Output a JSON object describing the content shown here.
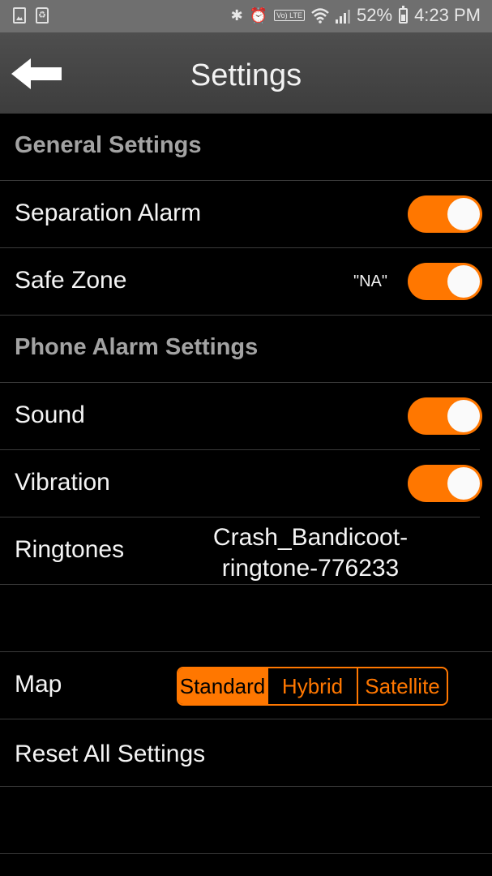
{
  "status_bar": {
    "left_icons": [
      "image-icon",
      "recycle-notification-icon"
    ],
    "right_icons": [
      "bluetooth-icon",
      "alarm-icon",
      "volte-icon",
      "wifi-icon",
      "signal-icon"
    ],
    "volte_label": "Vo) LTE",
    "battery_percent": "52%",
    "battery_level": 0.52,
    "time": "4:23 PM"
  },
  "app_bar": {
    "back_icon": "back-arrow-icon",
    "title": "Settings"
  },
  "general_section": {
    "title": "General Settings",
    "separation_alarm": {
      "label": "Separation Alarm",
      "on": true
    },
    "safe_zone": {
      "label": "Safe Zone",
      "value": "\"NA\"",
      "on": true
    }
  },
  "phone_alarm_section": {
    "title": "Phone Alarm Settings",
    "sound": {
      "label": "Sound",
      "on": true
    },
    "vibration": {
      "label": "Vibration",
      "on": true
    },
    "ringtones": {
      "label": "Ringtones",
      "value_line1": "Crash_Bandicoot-",
      "value_line2": "ringtone-776233"
    }
  },
  "map": {
    "label": "Map",
    "options": [
      "Standard",
      "Hybrid",
      "Satellite"
    ],
    "selected": "Standard"
  },
  "reset": {
    "label": "Reset All Settings"
  },
  "colors": {
    "accent": "#ff7700",
    "background": "#000000",
    "section_title": "#a3a3a3",
    "app_bar": "#444444",
    "status_bar": "#6f6f6f"
  }
}
